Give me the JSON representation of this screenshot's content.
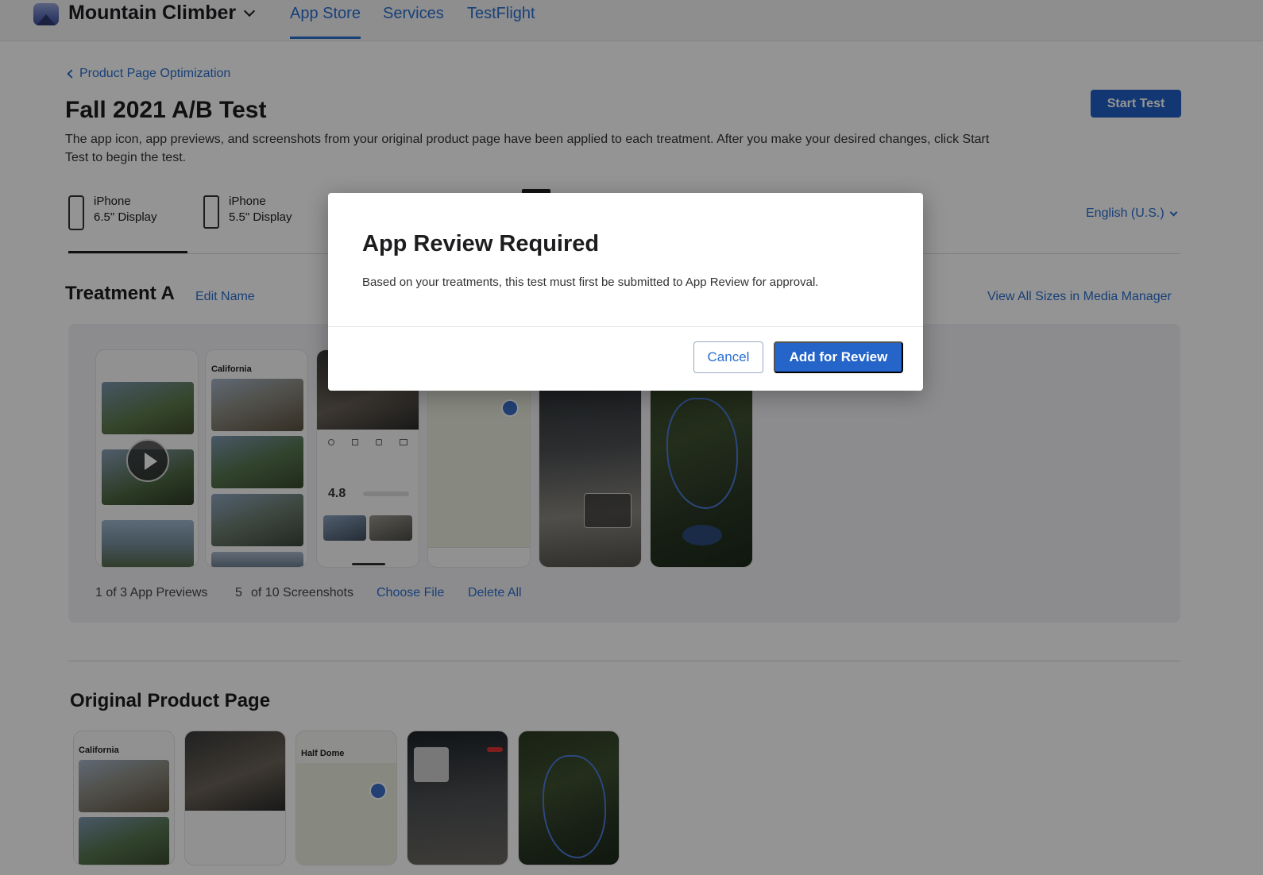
{
  "header": {
    "app_name": "Mountain Climber",
    "tabs": [
      {
        "label": "App Store",
        "active": true
      },
      {
        "label": "Services",
        "active": false
      },
      {
        "label": "TestFlight",
        "active": false
      }
    ]
  },
  "breadcrumb": {
    "back_label": "Product Page Optimization"
  },
  "page": {
    "title": "Fall 2021 A/B Test",
    "description": "The app icon, app previews, and screenshots from your original product page have been applied to each treatment. After you make your desired changes, click Start Test to begin the test.",
    "start_button": "Start Test"
  },
  "devices": [
    {
      "line1": "iPhone",
      "line2": "6.5\" Display",
      "active": true
    },
    {
      "line1": "iPhone",
      "line2": "5.5\" Display",
      "active": false
    }
  ],
  "language": "English (U.S.)",
  "treatment": {
    "title": "Treatment A",
    "edit_name": "Edit Name",
    "view_all": "View All Sizes in Media Manager",
    "previews_count": "1 of 3 App Previews",
    "screenshots_num": "5",
    "screenshots_count": "of 10 Screenshots",
    "choose_file": "Choose File",
    "delete_all": "Delete All",
    "shot_labels": {
      "california": "California",
      "rating": "4.8"
    }
  },
  "original": {
    "title": "Original Product Page",
    "shot_labels": {
      "california": "California",
      "half_dome": "Half Dome"
    }
  },
  "modal": {
    "title": "App Review Required",
    "body": "Based on your treatments, this test must first be submitted to App Review for approval.",
    "cancel": "Cancel",
    "confirm": "Add for Review"
  },
  "colors": {
    "accent": "#2a6ecf",
    "primary_button": "#1f5fc5"
  }
}
